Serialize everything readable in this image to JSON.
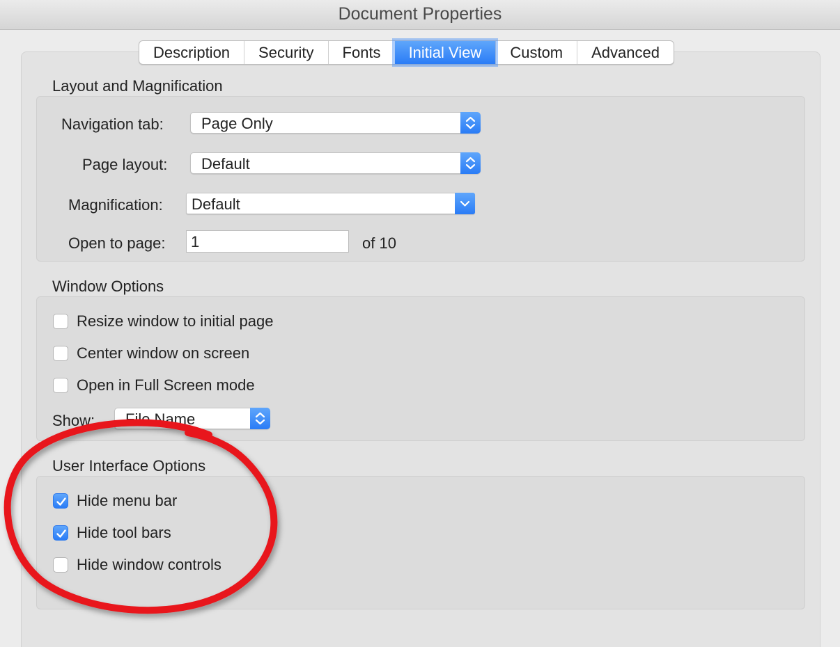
{
  "window": {
    "title": "Document Properties"
  },
  "tabs": [
    {
      "label": "Description",
      "active": false
    },
    {
      "label": "Security",
      "active": false
    },
    {
      "label": "Fonts",
      "active": false
    },
    {
      "label": "Initial View",
      "active": true
    },
    {
      "label": "Custom",
      "active": false
    },
    {
      "label": "Advanced",
      "active": false
    }
  ],
  "layout": {
    "title": "Layout and Magnification",
    "navigation_tab": {
      "label": "Navigation tab:",
      "value": "Page Only"
    },
    "page_layout": {
      "label": "Page layout:",
      "value": "Default"
    },
    "magnification": {
      "label": "Magnification:",
      "value": "Default"
    },
    "open_to_page": {
      "label": "Open to page:",
      "value": "1",
      "of_text": "of 10"
    }
  },
  "window_options": {
    "title": "Window Options",
    "resize": {
      "label": "Resize window to initial page",
      "checked": false
    },
    "center": {
      "label": "Center window on screen",
      "checked": false
    },
    "fullscreen": {
      "label": "Open in Full Screen mode",
      "checked": false
    },
    "show": {
      "label": "Show:",
      "value": "File Name"
    }
  },
  "ui_options": {
    "title": "User Interface Options",
    "hide_menu_bar": {
      "label": "Hide menu bar",
      "checked": true
    },
    "hide_tool_bars": {
      "label": "Hide tool bars",
      "checked": true
    },
    "hide_window_controls": {
      "label": "Hide window controls",
      "checked": false
    }
  },
  "colors": {
    "accent": "#2a7cf6",
    "annotation": "#e8141b",
    "window_background": "#ececec"
  },
  "icons": {
    "stepper": "up-down-chevron-icon",
    "dropdown": "chevron-down-icon",
    "check": "checkmark-icon"
  }
}
